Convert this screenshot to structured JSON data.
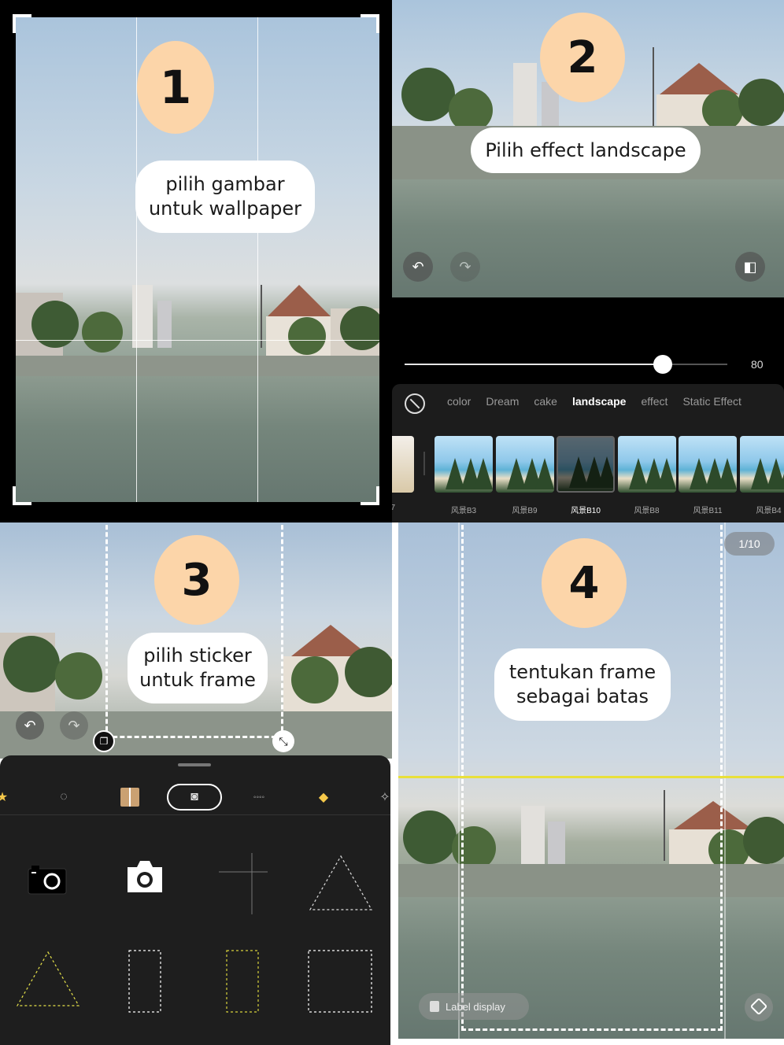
{
  "step1": {
    "number": "1",
    "caption": "pilih gambar\nuntuk wallpaper"
  },
  "step2": {
    "number": "2",
    "caption": "Pilih effect landscape",
    "slider_value": "80",
    "slider_level": 0.8,
    "tabs": [
      "color",
      "Dream",
      "cake",
      "landscape",
      "effect",
      "Static Effect"
    ],
    "active_tab": "landscape",
    "thumb_labels": [
      "风景B3",
      "风景B9",
      "风景B10",
      "风景B8",
      "风景B11",
      "风景B4"
    ],
    "selected_thumb": "风景B10",
    "partial_label": "7"
  },
  "step3": {
    "number": "3",
    "caption": "pilih sticker\nuntuk frame"
  },
  "step4": {
    "number": "4",
    "caption": "tentukan frame\nsebagai batas",
    "counter": "1/10",
    "label_display": "Label display"
  },
  "colors": {
    "badge": "#fcd5a9",
    "accent_line": "#e9e03a"
  }
}
